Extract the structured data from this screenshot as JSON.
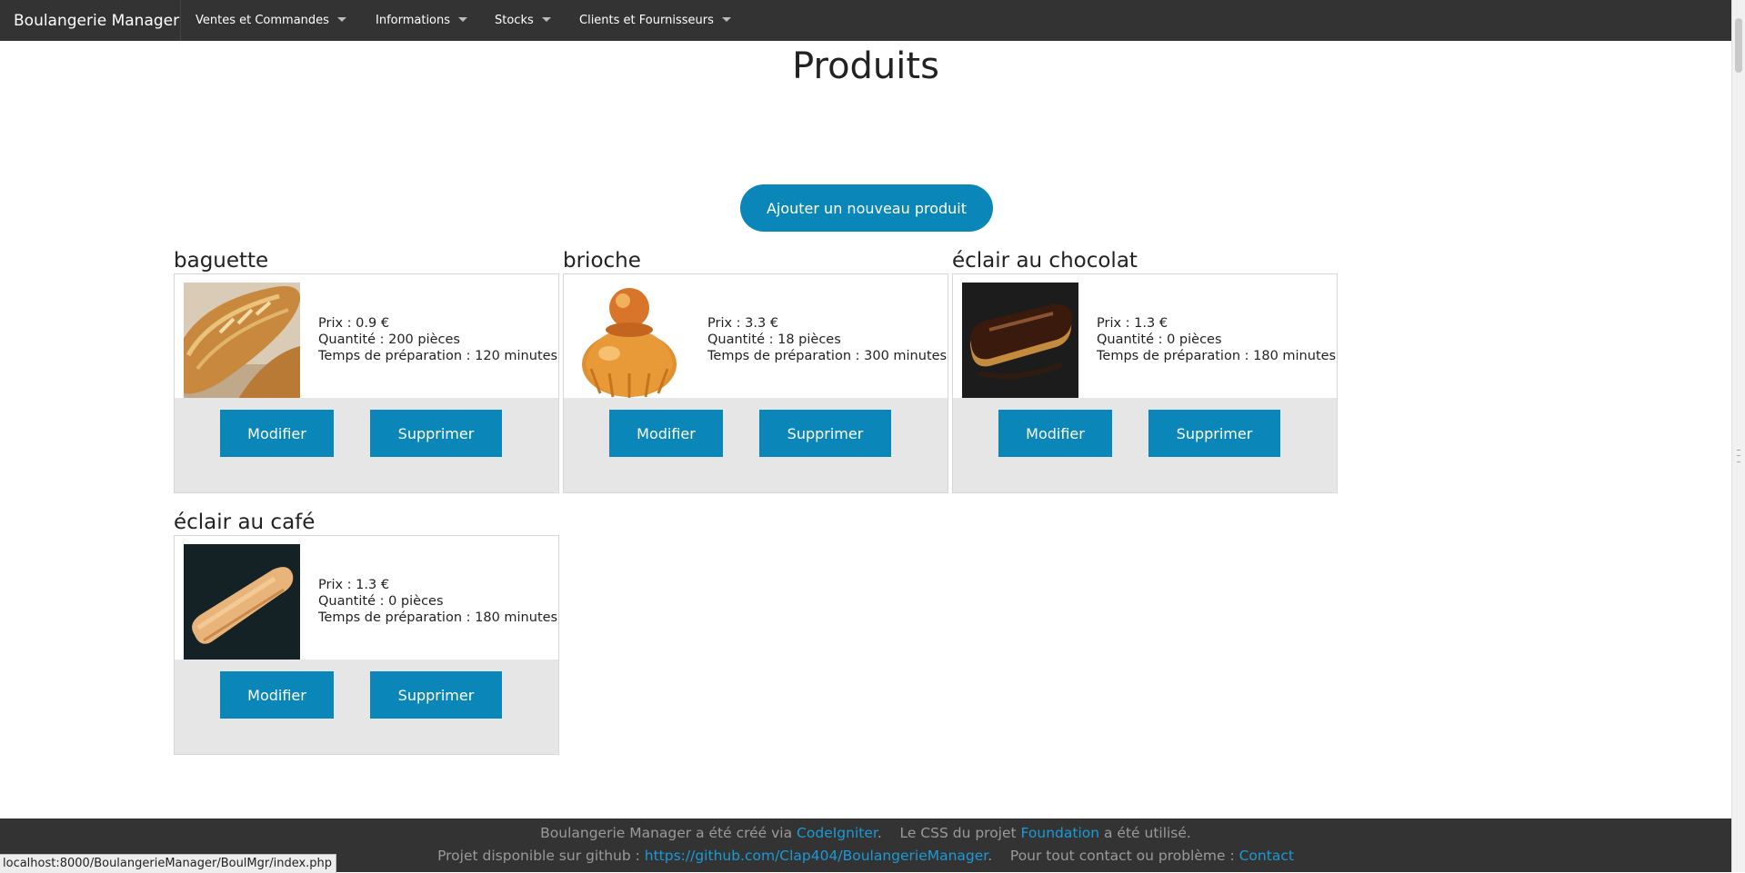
{
  "navbar": {
    "brand": "Boulangerie Manager",
    "menus": [
      {
        "label": "Ventes et Commandes"
      },
      {
        "label": "Informations"
      },
      {
        "label": "Stocks"
      },
      {
        "label": "Clients et Fournisseurs"
      }
    ]
  },
  "page": {
    "title": "Produits",
    "add_button": "Ajouter un nouveau produit"
  },
  "products": [
    {
      "name": "baguette",
      "price": "Prix : 0.9 €",
      "quantity": "Quantité : 200 pièces",
      "prep": "Temps de préparation : 120 minutes",
      "edit": "Modifier",
      "delete": "Supprimer"
    },
    {
      "name": "brioche",
      "price": "Prix : 3.3 €",
      "quantity": "Quantité : 18 pièces",
      "prep": "Temps de préparation : 300 minutes",
      "edit": "Modifier",
      "delete": "Supprimer"
    },
    {
      "name": "éclair au chocolat",
      "price": "Prix : 1.3 €",
      "quantity": "Quantité : 0 pièces",
      "prep": "Temps de préparation : 180 minutes",
      "edit": "Modifier",
      "delete": "Supprimer"
    },
    {
      "name": "éclair au café",
      "price": "Prix : 1.3 €",
      "quantity": "Quantité : 0 pièces",
      "prep": "Temps de préparation : 180 minutes",
      "edit": "Modifier",
      "delete": "Supprimer"
    }
  ],
  "footer": {
    "line1_a": "Boulangerie Manager a été créé via ",
    "link_codeigniter": "CodeIgniter",
    "line1_b": ".    Le CSS du projet ",
    "link_foundation": "Foundation",
    "line1_c": " a été utilisé.",
    "line2_a": "Projet disponible sur github : ",
    "link_github": "https://github.com/Clap404/BoulangerieManager",
    "line2_b": ".    Pour tout contact ou problème : ",
    "link_contact": "Contact"
  },
  "status_bar": {
    "url": "localhost:8000/BoulangerieManager/BoulMgr/index.php"
  }
}
